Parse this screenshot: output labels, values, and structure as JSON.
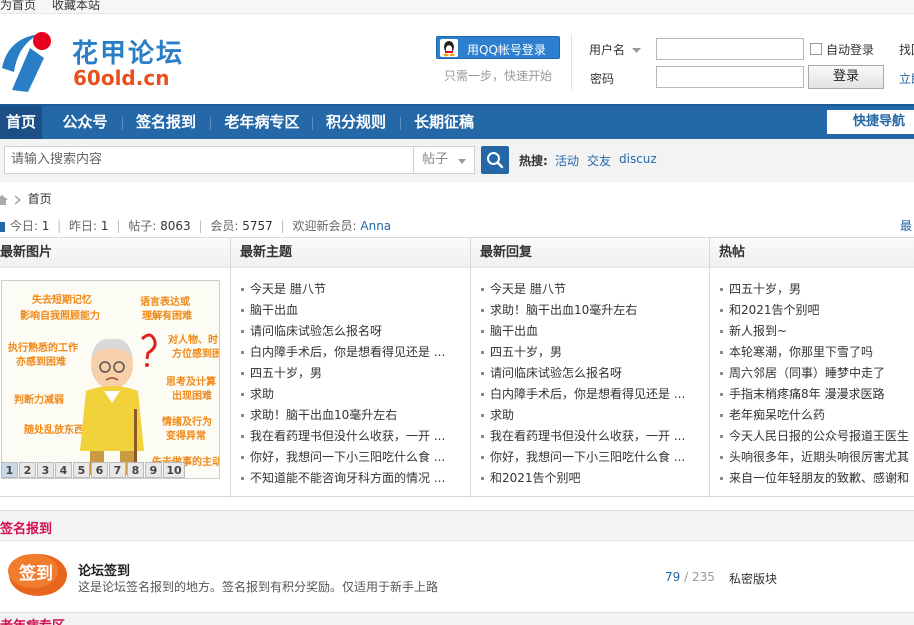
{
  "topbar": {
    "set_home": "设为首页",
    "bookmark": "收藏本站"
  },
  "header": {
    "logo_cn": "花甲论坛",
    "logo_url": "60old.cn",
    "qq_login": "用QQ帐号登录",
    "qq_hint": "只需一步，快速开始",
    "username_label": "用户名",
    "password_label": "密码",
    "auto_login": "自动登录",
    "login_button": "登录",
    "find_password": "找回",
    "register": "立即"
  },
  "nav": {
    "items": [
      {
        "label": "首页"
      },
      {
        "label": "公众号"
      },
      {
        "label": "签名报到"
      },
      {
        "label": "老年病专区"
      },
      {
        "label": "积分规则"
      },
      {
        "label": "长期征稿"
      }
    ],
    "quick_nav": "快捷导航"
  },
  "search": {
    "placeholder": "请输入搜索内容",
    "scope": "帖子",
    "hot_label": "热搜:",
    "hot_links": [
      "活动",
      "交友",
      "discuz"
    ]
  },
  "breadcrumb": {
    "home": "首页"
  },
  "stats": {
    "today_label": "今日:",
    "today": "1",
    "yesterday_label": "昨日:",
    "yesterday": "1",
    "posts_label": "帖子:",
    "posts": "8063",
    "members_label": "会员:",
    "members": "5757",
    "welcome_label": "欢迎新会员:",
    "new_member": "Anna",
    "right_link": "最"
  },
  "columns": {
    "images": {
      "title": "最新图片",
      "pages": [
        "1",
        "2",
        "3",
        "4",
        "5",
        "6",
        "7",
        "8",
        "9",
        "10"
      ],
      "poster_texts": [
        "失去短期记忆",
        "影响自我照顾能力",
        "语言表达或",
        "理解有困难",
        "对人物、时",
        "方位感到困",
        "执行熟悉的工作",
        "亦感到困难",
        "判断力减弱",
        "思考及计算",
        "出现困难",
        "随处乱放东西",
        "情绪及行为",
        "变得异常",
        "失去做事的主动"
      ]
    },
    "topics": {
      "title": "最新主题",
      "items": [
        "今天是 腊八节",
        "脑干出血",
        "请问临床试验怎么报名呀",
        "白内障手术后，你是想看得见还是 ...",
        "四五十岁，男",
        "求助",
        "求助！脑干出血10毫升左右",
        "我在看药理书但没什么收获，一开 ...",
        "你好，我想问一下小三阳吃什么食 ...",
        "不知道能不能咨询牙科方面的情况 ..."
      ]
    },
    "replies": {
      "title": "最新回复",
      "items": [
        "今天是 腊八节",
        "求助！脑干出血10毫升左右",
        "脑干出血",
        "四五十岁，男",
        "请问临床试验怎么报名呀",
        "白内障手术后，你是想看得见还是 ...",
        "求助",
        "我在看药理书但没什么收获，一开 ...",
        "你好，我想问一下小三阳吃什么食 ...",
        "和2021告个别吧"
      ]
    },
    "hot": {
      "title": "热帖",
      "items": [
        "四五十岁，男",
        "和2021告个别吧",
        "新人报到~",
        "本轮寒潮，你那里下雪了吗",
        "周六邻居（同事）睡梦中走了",
        "手指末梢疼痛8年 漫漫求医路",
        "老年痴呆吃什么药",
        "今天人民日报的公众号报道王医生",
        "头响很多年，近期头响很厉害尤其",
        "来自一位年轻朋友的致歉、感谢和"
      ]
    }
  },
  "section": {
    "title": "签名报到",
    "forum": {
      "icon_text": "签到",
      "name": "论坛签到",
      "description": "这是论坛签名报到的地方。签名报到有积分奖励。仅适用于新手上路",
      "threads": "79",
      "separator": " / ",
      "posts": "235",
      "private": "私密版块"
    },
    "next_title": "老年病专区"
  },
  "colors": {
    "nav_blue": "#2468a8",
    "section_red": "#d0104c",
    "logo_orange": "#e8501c",
    "logo_blue": "#2a7ec8"
  }
}
